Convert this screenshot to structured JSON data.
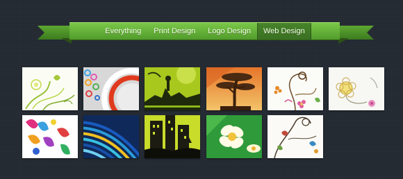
{
  "nav": {
    "items": [
      {
        "label": "Everything",
        "active": false
      },
      {
        "label": "Print Design",
        "active": false
      },
      {
        "label": "Logo Design",
        "active": false
      },
      {
        "label": "Web Design",
        "active": true
      }
    ]
  },
  "colors": {
    "background": "#252b33",
    "ribbon_green": "#5aa832",
    "ribbon_dark": "#3a7022"
  },
  "gallery": {
    "thumbnails": [
      {
        "name": "floral-swirl-green"
      },
      {
        "name": "retro-circles-red"
      },
      {
        "name": "green-grunge-silhouette"
      },
      {
        "name": "bonsai-tree-sunset"
      },
      {
        "name": "floral-ornament-pink"
      },
      {
        "name": "flower-line-art"
      },
      {
        "name": "colorful-paisley"
      },
      {
        "name": "blue-swirl-stripes"
      },
      {
        "name": "city-skyline-grunge"
      },
      {
        "name": "plumeria-flowers"
      },
      {
        "name": "decorative-vines"
      }
    ]
  }
}
